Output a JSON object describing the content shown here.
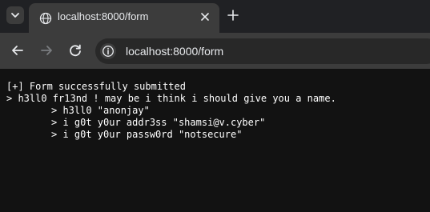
{
  "browser": {
    "tab": {
      "title": "localhost:8000/form"
    },
    "address_bar": {
      "url": "localhost:8000/form"
    },
    "icons": [
      "chevron-down-icon",
      "globe-icon",
      "close-icon",
      "plus-icon",
      "back-arrow-icon",
      "forward-arrow-icon",
      "reload-icon",
      "info-icon"
    ]
  },
  "page": {
    "lines": [
      "[+] Form successfully submitted",
      "> h3ll0 fr13nd ! may be i think i should give you a name.",
      "> h3ll0 \"anonjay\"",
      "> i g0t y0ur addr3ss \"shamsi@v.cyber\"",
      "> i g0t y0ur passw0rd \"notsecure\""
    ]
  }
}
